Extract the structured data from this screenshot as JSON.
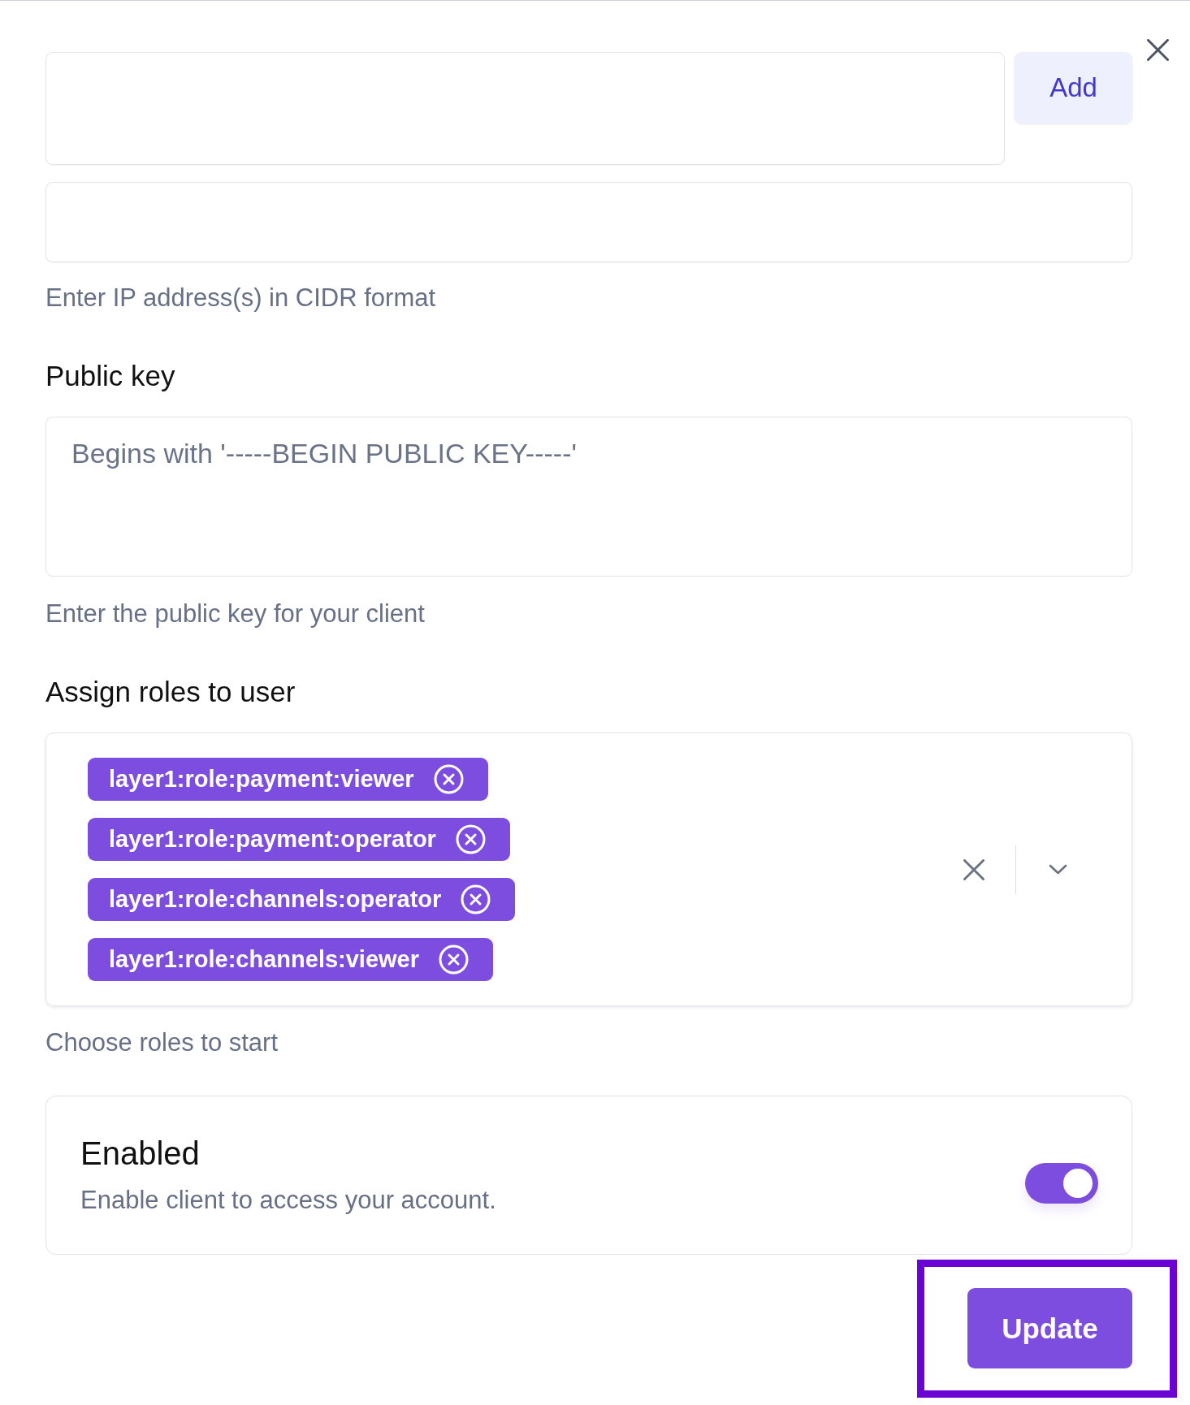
{
  "ip_address": {
    "add_button": "Add",
    "hint": "Enter IP address(s) in CIDR format"
  },
  "public_key": {
    "label": "Public key",
    "placeholder": "Begins with '-----BEGIN PUBLIC KEY-----'",
    "hint": "Enter the public key for your client"
  },
  "roles": {
    "label": "Assign roles to user",
    "tags": [
      {
        "label": "layer1:role:payment:viewer"
      },
      {
        "label": "layer1:role:payment:operator"
      },
      {
        "label": "layer1:role:channels:operator"
      },
      {
        "label": "layer1:role:channels:viewer"
      }
    ],
    "hint": "Choose roles to start"
  },
  "enabled": {
    "title": "Enabled",
    "description": "Enable client to access your account.",
    "on": true
  },
  "update_button": {
    "label": "Update",
    "highlighted": true
  }
}
